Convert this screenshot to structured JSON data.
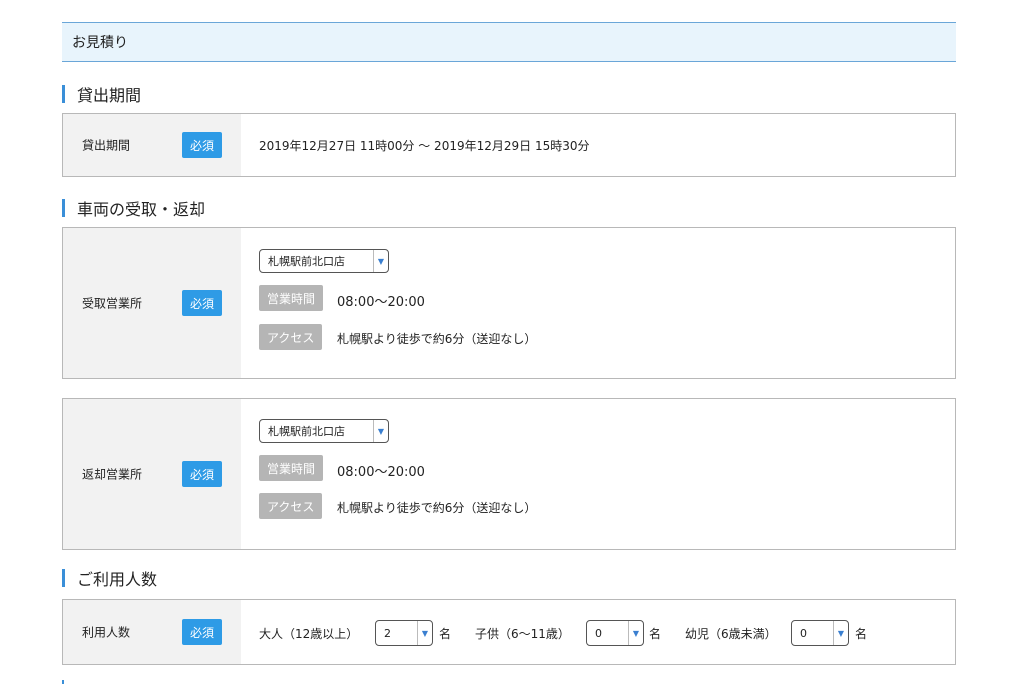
{
  "header": {
    "title": "お見積り"
  },
  "sections": {
    "period": {
      "title": "貸出期間"
    },
    "vehicle": {
      "title": "車両の受取・返却"
    },
    "people": {
      "title": "ご利用人数"
    }
  },
  "period_panel": {
    "label": "貸出期間",
    "required": "必須",
    "value": "2019年12月27日 11時00分 〜 2019年12月29日 15時30分"
  },
  "pickup": {
    "label": "受取営業所",
    "required": "必須",
    "selected": "札幌駅前北口店",
    "hours_tag": "営業時間",
    "hours": "08:00〜20:00",
    "access_tag": "アクセス",
    "access": "札幌駅より徒歩で約6分（送迎なし）"
  },
  "return": {
    "label": "返却営業所",
    "required": "必須",
    "selected": "札幌駅前北口店",
    "hours_tag": "営業時間",
    "hours": "08:00〜20:00",
    "access_tag": "アクセス",
    "access": "札幌駅より徒歩で約6分（送迎なし）"
  },
  "people_panel": {
    "label": "利用人数",
    "required": "必須",
    "adult_label": "大人（12歳以上）",
    "adult_value": "2",
    "child_label": "子供（6〜11歳）",
    "child_value": "0",
    "infant_label": "幼児（6歳未満）",
    "infant_value": "0",
    "unit": "名"
  },
  "colors": {
    "accent": "#2e9be6",
    "header_bg": "#e8f4fc",
    "tag_gray": "#b5b5b5",
    "label_bg": "#f2f2f2"
  }
}
